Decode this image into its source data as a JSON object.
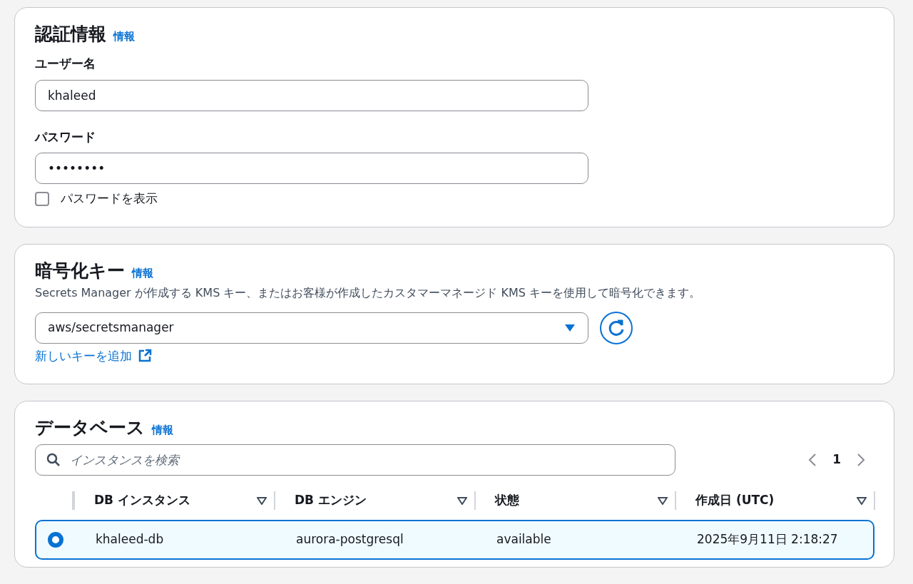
{
  "credentials": {
    "title": "認証情報",
    "info_link": "情報",
    "username": {
      "label": "ユーザー名",
      "value": "khaleed"
    },
    "password": {
      "label": "パスワード",
      "value": "••••••••"
    },
    "show_password": {
      "label": "パスワードを表示",
      "checked": false
    }
  },
  "encryption_key": {
    "title": "暗号化キー",
    "info_link": "情報",
    "description": "Secrets Manager が作成する KMS キー、またはお客様が作成したカスタマーマネージド KMS キーを使用して暗号化できます。",
    "select": {
      "value": "aws/secretsmanager"
    },
    "add_key_link": "新しいキーを追加"
  },
  "database": {
    "title": "データベース",
    "info_link": "情報",
    "search": {
      "placeholder": "インスタンスを検索"
    },
    "pagination": {
      "page": "1"
    },
    "table": {
      "columns": [
        "DB インスタンス",
        "DB エンジン",
        "状態",
        "作成日 (UTC)"
      ],
      "rows": [
        {
          "selected": true,
          "cells": [
            "khaleed-db",
            "aurora-postgresql",
            "available",
            "2025年9月11日 2:18:27"
          ]
        }
      ]
    }
  }
}
